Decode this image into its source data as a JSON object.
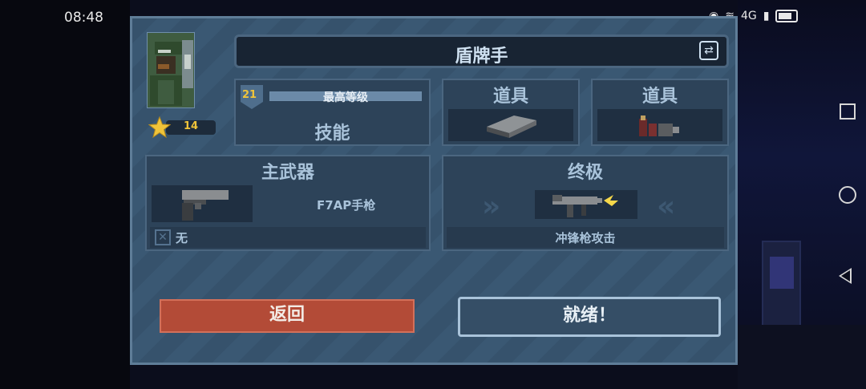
{
  "status_bar": {
    "time": "08:48",
    "network": "4G"
  },
  "hero": {
    "name": "盾牌手",
    "star_level": "14",
    "level_badge": "21",
    "xp_label": "最高等级",
    "xp_fraction": 1.0,
    "skill_label": "技能"
  },
  "items": [
    {
      "title": "道具",
      "icon": "brick-icon"
    },
    {
      "title": "道具",
      "icon": "bullets-icon"
    }
  ],
  "main_weapon": {
    "title": "主武器",
    "name": "F7AP手枪",
    "icon": "pistol-icon",
    "secondary": "无"
  },
  "ultimate": {
    "title": "终极",
    "name": "冲锋枪攻击",
    "icon": "smg-icon"
  },
  "buttons": {
    "back": "返回",
    "ready": "就绪！"
  },
  "colors": {
    "back_button": "#b34b37",
    "panel": "#36526c",
    "gold": "#f0c43a"
  }
}
